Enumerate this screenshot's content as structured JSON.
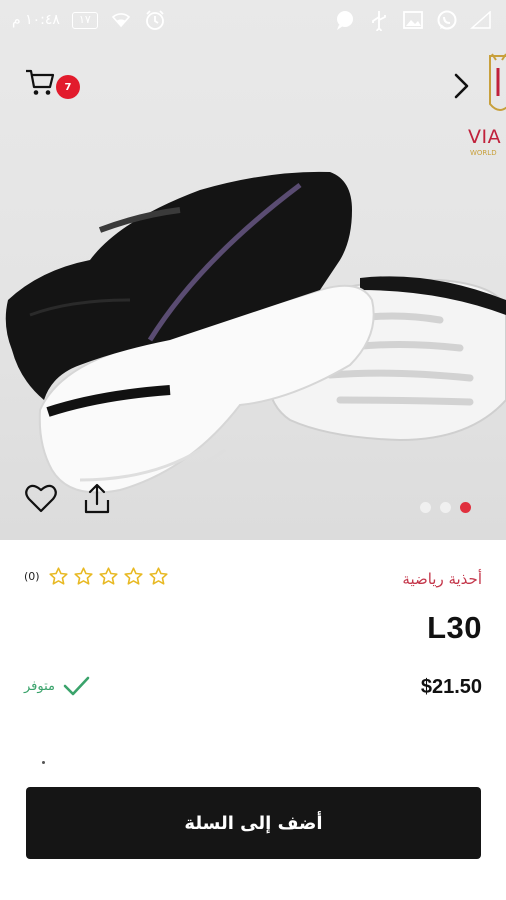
{
  "status_bar": {
    "time": "١٠:٤٨ م",
    "battery": "١٧"
  },
  "header": {
    "cart_count": "7",
    "logo_text": "VIA",
    "logo_subtext": "WORLD"
  },
  "gallery": {
    "image_count": 3,
    "active_index": 0
  },
  "product": {
    "category": "أحذية رياضية",
    "name": "L30",
    "price": "$21.50",
    "stock_status": "متوفر",
    "review_count": "(0)",
    "rating": 0,
    "max_rating": 5
  },
  "actions": {
    "add_to_cart_label": "أضف إلى السلة"
  },
  "colors": {
    "accent": "#e21b2c",
    "category_text": "#c4364a",
    "in_stock": "#3aa36b",
    "star": "#e8b923",
    "button_bg": "#151515"
  }
}
